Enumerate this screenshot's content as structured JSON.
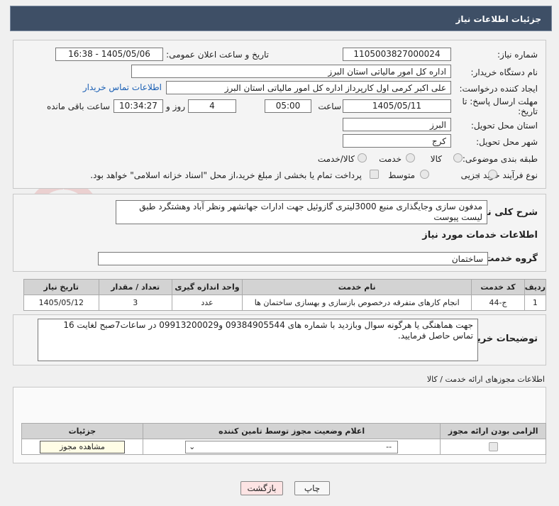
{
  "header": {
    "title": "جزئیات اطلاعات نیاز"
  },
  "form": {
    "need_number_label": "شماره نیاز:",
    "need_number": "1105003827000024",
    "announce_label": "تاریخ و ساعت اعلان عمومی:",
    "announce_value": "1405/05/06 - 16:38",
    "buyer_label": "نام دستگاه خریدار:",
    "buyer_value": "اداره کل امور مالیاتی استان البرز",
    "creator_label": "ایجاد کننده درخواست:",
    "creator_value": "علی اکبر کرمی اول کارپرداز اداره کل امور مالیاتی استان البرز",
    "contact_link": "اطلاعات تماس خریدار",
    "deadline_label": "مهلت ارسال پاسخ: تا",
    "deadline_label2": "تاریخ:",
    "deadline_date": "1405/05/11",
    "time_label": "ساعت",
    "deadline_time": "05:00",
    "days_value": "4",
    "days_label": "روز و",
    "remaining_time": "10:34:27",
    "remaining_label": "ساعت باقی مانده",
    "province_label": "استان محل تحویل:",
    "province_value": "البرز",
    "city_label": "شهر محل تحویل:",
    "city_value": "کرج",
    "category_label": "طبقه بندی موضوعی:",
    "category_options": [
      "کالا",
      "خدمت",
      "کالا/خدمت"
    ],
    "process_label": "نوع فرآیند خرید :",
    "process_options": [
      "جزیی",
      "متوسط"
    ],
    "payment_note": "پرداخت تمام یا بخشی از مبلغ خرید،از محل \"اسناد خزانه اسلامی\" خواهد بود."
  },
  "summary": {
    "label": "شرح کلی نیاز:",
    "value": "مدفون سازی وجایگذاری منبع 3000لیتری گازوئیل جهت ادارات جهانشهر ونظر آباد وهشتگرد طبق لیست پیوست"
  },
  "services": {
    "title": "اطلاعات خدمات مورد نیاز",
    "group_label": "گروه خدمت:",
    "group_value": "ساختمان",
    "columns": [
      "ردیف",
      "کد خدمت",
      "نام خدمت",
      "واحد اندازه گیری",
      "تعداد / مقدار",
      "تاریخ نیاز"
    ],
    "rows": [
      {
        "idx": "1",
        "code": "ج-44",
        "name": "انجام کارهای متفرقه درخصوص بازسازی و بهسازی ساختمان ها",
        "unit": "عدد",
        "qty": "3",
        "date": "1405/05/12"
      }
    ]
  },
  "buyer_notes": {
    "label": "توضیحات خریدار:",
    "value": "جهت هماهنگی یا هرگونه سوال وبازدید با شماره های 09384905544 و09913200029 در ساعات7صبح لغایت 16 تماس حاصل فرمایید."
  },
  "permits": {
    "title": "اطلاعات مجوزهای ارائه خدمت / کالا",
    "columns": [
      "الزامی بودن ارائه مجوز",
      "اعلام وضعیت مجوز توسط تامین کننده",
      "جزئیات"
    ],
    "select_value": "--",
    "view_button": "مشاهده مجوز"
  },
  "actions": {
    "print": "چاپ",
    "back": "بازگشت"
  },
  "watermark": "AriaTender.net"
}
